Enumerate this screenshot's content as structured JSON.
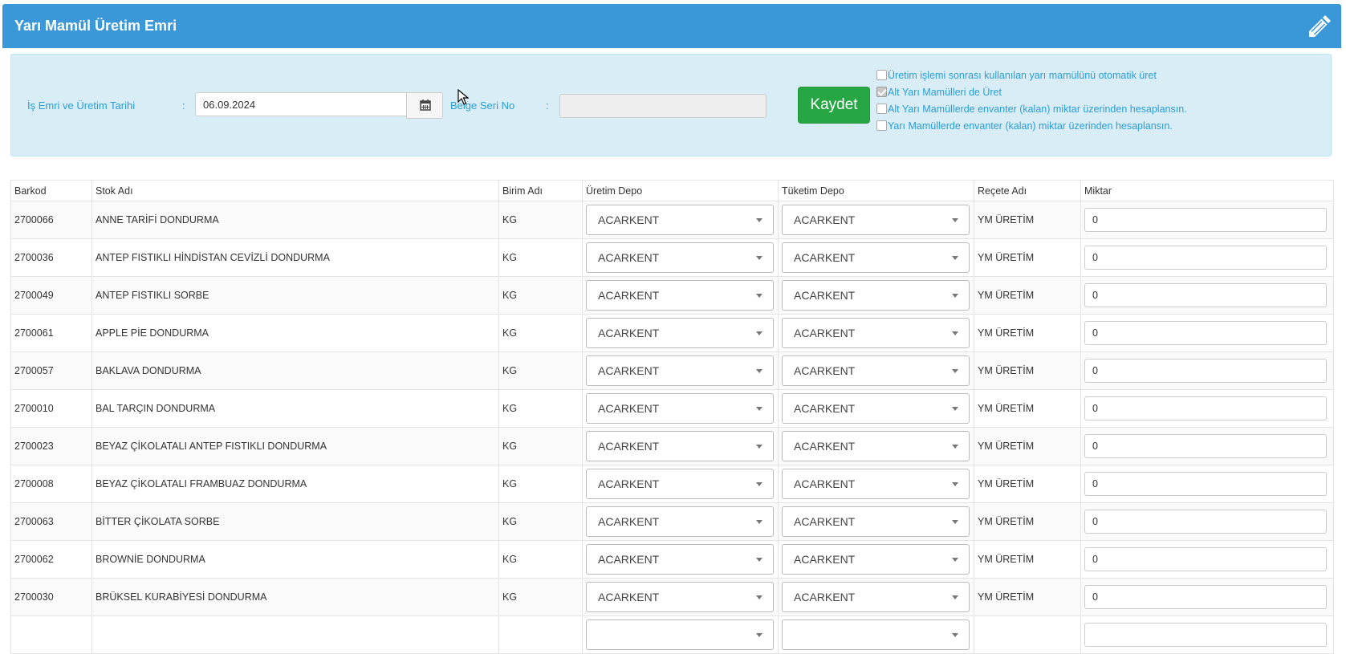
{
  "header": {
    "title": "Yarı Mamül Üretim Emri",
    "icon": "pencil-icon"
  },
  "filters": {
    "date_label": "İş Emri ve Üretim Tarihi",
    "colon": ":",
    "date_value": "06.09.2024",
    "seri_label": "Belge Seri No",
    "seri_value": "",
    "save_label": "Kaydet",
    "options": [
      {
        "label": "Üretim işlemi sonrası kullanılan yarı mamülünü otomatik üret",
        "checked": false
      },
      {
        "label": "Alt Yarı Mamülleri de Üret",
        "checked": true
      },
      {
        "label": "Alt Yarı Mamüllerde envanter (kalan) miktar üzerinden hesaplansın.",
        "checked": false
      },
      {
        "label": "Yarı Mamüllerde envanter (kalan) miktar üzerinden hesaplansın.",
        "checked": false
      }
    ]
  },
  "table": {
    "columns": [
      "Barkod",
      "Stok Adı",
      "Birim Adı",
      "Üretim Depo",
      "Tüketim Depo",
      "Reçete Adı",
      "Miktar"
    ],
    "rows": [
      {
        "barkod": "2700066",
        "stok": "ANNE TARİFİ DONDURMA",
        "birim": "KG",
        "uretim": "ACARKENT",
        "tuketim": "ACARKENT",
        "recete": "YM ÜRETİM",
        "miktar": "0"
      },
      {
        "barkod": "2700036",
        "stok": "ANTEP FISTIKLI HİNDİSTAN CEVİZLİ DONDURMA",
        "birim": "KG",
        "uretim": "ACARKENT",
        "tuketim": "ACARKENT",
        "recete": "YM ÜRETİM",
        "miktar": "0"
      },
      {
        "barkod": "2700049",
        "stok": "ANTEP FISTIKLI SORBE",
        "birim": "KG",
        "uretim": "ACARKENT",
        "tuketim": "ACARKENT",
        "recete": "YM ÜRETİM",
        "miktar": "0"
      },
      {
        "barkod": "2700061",
        "stok": "APPLE PİE DONDURMA",
        "birim": "KG",
        "uretim": "ACARKENT",
        "tuketim": "ACARKENT",
        "recete": "YM ÜRETİM",
        "miktar": "0"
      },
      {
        "barkod": "2700057",
        "stok": "BAKLAVA DONDURMA",
        "birim": "KG",
        "uretim": "ACARKENT",
        "tuketim": "ACARKENT",
        "recete": "YM ÜRETİM",
        "miktar": "0"
      },
      {
        "barkod": "2700010",
        "stok": "BAL TARÇIN DONDURMA",
        "birim": "KG",
        "uretim": "ACARKENT",
        "tuketim": "ACARKENT",
        "recete": "YM ÜRETİM",
        "miktar": "0"
      },
      {
        "barkod": "2700023",
        "stok": "BEYAZ ÇİKOLATALI ANTEP FISTIKLI DONDURMA",
        "birim": "KG",
        "uretim": "ACARKENT",
        "tuketim": "ACARKENT",
        "recete": "YM ÜRETİM",
        "miktar": "0"
      },
      {
        "barkod": "2700008",
        "stok": "BEYAZ ÇİKOLATALI FRAMBUAZ DONDURMA",
        "birim": "KG",
        "uretim": "ACARKENT",
        "tuketim": "ACARKENT",
        "recete": "YM ÜRETİM",
        "miktar": "0"
      },
      {
        "barkod": "2700063",
        "stok": "BİTTER ÇİKOLATA SORBE",
        "birim": "KG",
        "uretim": "ACARKENT",
        "tuketim": "ACARKENT",
        "recete": "YM ÜRETİM",
        "miktar": "0"
      },
      {
        "barkod": "2700062",
        "stok": "BROWNİE DONDURMA",
        "birim": "KG",
        "uretim": "ACARKENT",
        "tuketim": "ACARKENT",
        "recete": "YM ÜRETİM",
        "miktar": "0"
      },
      {
        "barkod": "2700030",
        "stok": "BRÜKSEL KURABİYESİ DONDURMA",
        "birim": "KG",
        "uretim": "ACARKENT",
        "tuketim": "ACARKENT",
        "recete": "YM ÜRETİM",
        "miktar": "0"
      },
      {
        "barkod": "",
        "stok": "",
        "birim": "",
        "uretim": "",
        "tuketim": "",
        "recete": "",
        "miktar": ""
      }
    ]
  }
}
